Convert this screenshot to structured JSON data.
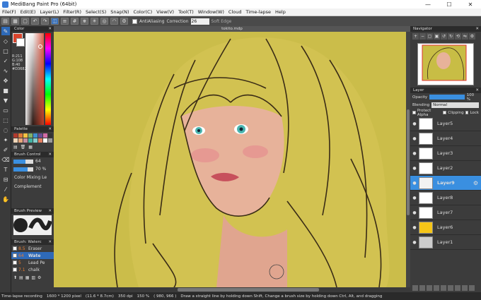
{
  "app": {
    "title": "MediBang Paint Pro (64bit)",
    "window_controls": [
      "—",
      "☐",
      "✕"
    ]
  },
  "menu": [
    "File(F)",
    "Edit(E)",
    "Layer(L)",
    "Filter(R)",
    "Select(S)",
    "Snap(N)",
    "Color(C)",
    "View(V)",
    "Tool(T)",
    "Window(W)",
    "Cloud",
    "Time-lapse",
    "Help"
  ],
  "toolbar": {
    "antialiasing_label": "AntiAliasing",
    "correction_label": "Correction",
    "correction_value": "26",
    "soft_edge_label": "Soft Edge"
  },
  "canvas": {
    "filename": "tokito.mdp",
    "background_color": "#c8bd45"
  },
  "color_panel": {
    "title": "Color",
    "fg_color": "#d8442c",
    "bg_color": "#ffffff",
    "r": "R:211",
    "g": "G:108",
    "b": "B:40",
    "hex": "#D36828"
  },
  "palette_panel": {
    "title": "Palette",
    "colors": [
      "#b03a2e",
      "#e07b39",
      "#f5c242",
      "#7fb069",
      "#3e8ed0",
      "#6a4c93",
      "#d16ba5",
      "#333333",
      "#f1d6b8",
      "#e8a87c",
      "#c38d9e",
      "#41b3a3",
      "#85cdca",
      "#e27d60",
      "#fefefe",
      "#999999"
    ]
  },
  "brush_control": {
    "title": "Brush Control",
    "size_value": "64",
    "size_fill": 0.62,
    "opacity_value": "70 %",
    "opacity_fill": 0.7,
    "mixing_label": "Color Mixing Le",
    "complement_label": "Complement"
  },
  "brush_preview": {
    "title": "Brush Preview"
  },
  "brush_list": {
    "title": "Brush: Waterc",
    "items": [
      {
        "num": "8.5",
        "name": "Eraser"
      },
      {
        "num": "64",
        "name": "Wate"
      },
      {
        "num": "5",
        "name": "Lead Pe"
      },
      {
        "num": "7.1",
        "name": "chalk"
      }
    ]
  },
  "navigator": {
    "title": "Navigator"
  },
  "layer_panel": {
    "title": "Layer",
    "opacity_label": "Opacity",
    "opacity_value": "100 %",
    "blending_label": "Blending",
    "blending_value": "Normal",
    "protect_alpha": "Protect Alpha",
    "clipping": "Clipping",
    "lock": "Lock",
    "layers": [
      {
        "name": "Layer5",
        "thumb": "#ffffff"
      },
      {
        "name": "Layer4",
        "thumb": "#ffffff"
      },
      {
        "name": "Layer3",
        "thumb": "#ffffff"
      },
      {
        "name": "Layer2",
        "thumb": "#ffffff"
      },
      {
        "name": "Layer9",
        "thumb": "#f2f2f2"
      },
      {
        "name": "Layer8",
        "thumb": "#ffffff"
      },
      {
        "name": "Layer7",
        "thumb": "#ffffff"
      },
      {
        "name": "Layer6",
        "thumb": "#f5c518"
      },
      {
        "name": "Layer1",
        "thumb": "#cccccc"
      }
    ]
  },
  "status": {
    "recording": "Time-lapse recording",
    "size": "1600 * 1200 pixel",
    "cm": "(11.6 * 8.7cm)",
    "dpi": "350 dpi",
    "zoom": "150 %",
    "coords": "( 980, 966 )",
    "hint": "Draw a straight line by holding down Shift, Change a brush size by holding down Ctrl, Alt, and dragging"
  }
}
